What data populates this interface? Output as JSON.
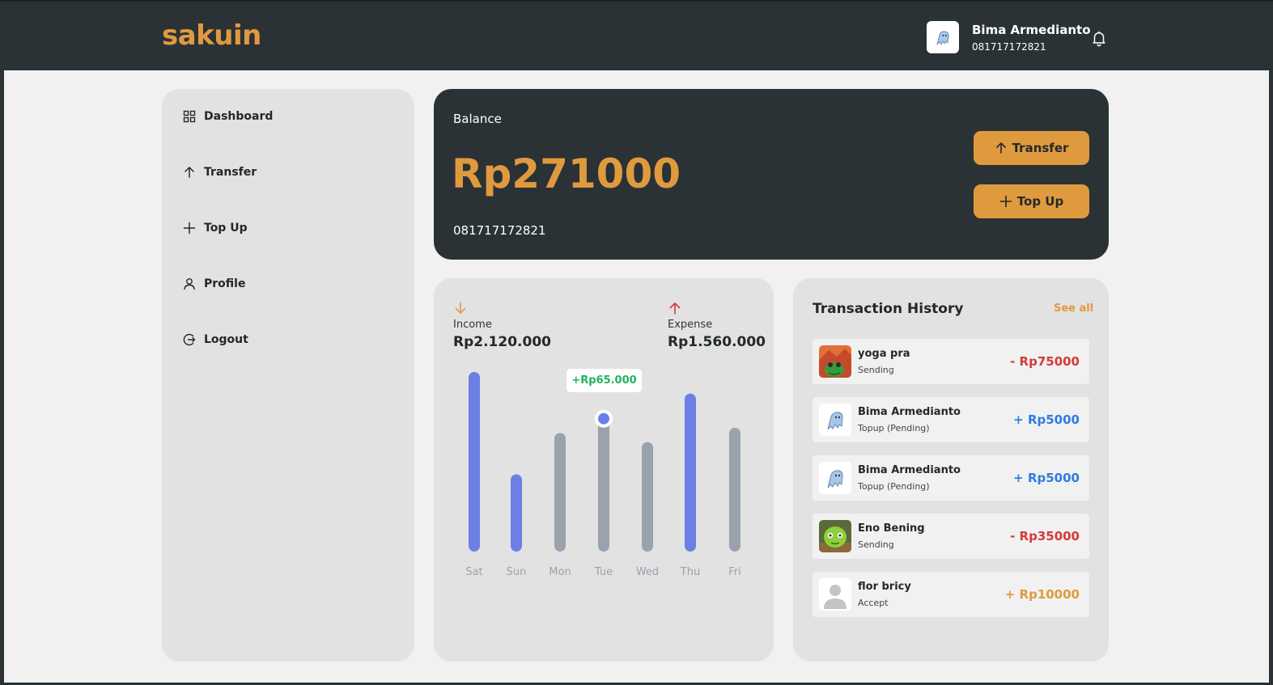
{
  "header": {
    "logo": "sakuin",
    "user": {
      "name": "Bima Armedianto",
      "phone": "081717172821",
      "avatar_icon": "ghost-avatar-icon"
    },
    "notification_icon": "bell-icon"
  },
  "sidebar": {
    "items": [
      {
        "label": "Dashboard",
        "icon": "grid-icon"
      },
      {
        "label": "Transfer",
        "icon": "arrow-up-icon"
      },
      {
        "label": "Top Up",
        "icon": "plus-icon"
      },
      {
        "label": "Profile",
        "icon": "user-icon"
      },
      {
        "label": "Logout",
        "icon": "logout-icon"
      }
    ]
  },
  "balance": {
    "label": "Balance",
    "amount": "Rp271000",
    "phone": "081717172821",
    "transfer_label": "Transfer",
    "topup_label": "Top Up"
  },
  "stats": {
    "income": {
      "label": "Income",
      "value": "Rp2.120.000",
      "icon": "arrow-down-icon"
    },
    "expense": {
      "label": "Expense",
      "value": "Rp1.560.000",
      "icon": "arrow-up-icon"
    },
    "tooltip": "+Rp65.000"
  },
  "chart_data": {
    "type": "bar",
    "categories": [
      "Sat",
      "Sun",
      "Mon",
      "Tue",
      "Wed",
      "Thu",
      "Fri"
    ],
    "values": [
      100,
      43,
      66,
      74,
      61,
      88,
      69
    ],
    "highlighted": [
      true,
      true,
      false,
      false,
      false,
      true,
      false
    ],
    "selected_index": 3,
    "tooltip": "+Rp65.000",
    "ylim": [
      0,
      100
    ],
    "grid": false,
    "colors": {
      "highlight": "#6b7fe6",
      "default": "#9aa2ae",
      "marker": "#6b7fe6"
    }
  },
  "history": {
    "title": "Transaction History",
    "see_all": "See all",
    "items": [
      {
        "name": "yoga pra",
        "status": "Sending",
        "amount": "- Rp75000",
        "color": "#d63a3a",
        "avatar": "frog-avatar"
      },
      {
        "name": "Bima Armedianto",
        "status": "Topup (Pending)",
        "amount": "+ Rp5000",
        "color": "#2f7de0",
        "avatar": "ghost-avatar"
      },
      {
        "name": "Bima Armedianto",
        "status": "Topup (Pending)",
        "amount": "+ Rp5000",
        "color": "#2f7de0",
        "avatar": "ghost-avatar"
      },
      {
        "name": "Eno Bening",
        "status": "Sending",
        "amount": "- Rp35000",
        "color": "#d63a3a",
        "avatar": "green-avatar"
      },
      {
        "name": "flor bricy",
        "status": "Accept",
        "amount": "+ Rp10000",
        "color": "#e09a3e",
        "avatar": "default-person-avatar"
      }
    ]
  },
  "colors": {
    "accent": "#e09a3e",
    "dark": "#2b3236",
    "panel": "#e2e2e2"
  }
}
